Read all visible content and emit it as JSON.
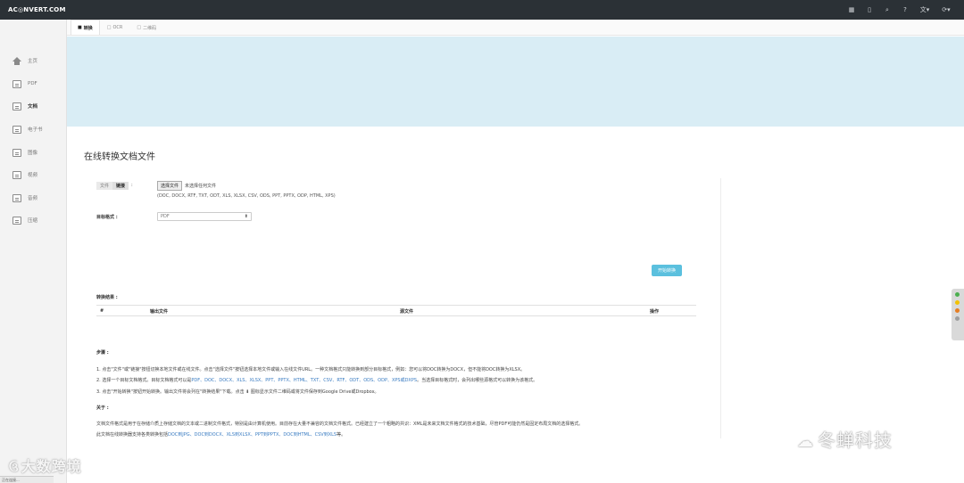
{
  "brand": {
    "logo": "AC◎NVERT.COM"
  },
  "navbar": {
    "icons": [
      {
        "name": "grid-icon",
        "glyph": "▦"
      },
      {
        "name": "bookmark-icon",
        "glyph": "▯"
      },
      {
        "name": "search-icon",
        "glyph": "⌕"
      },
      {
        "name": "help-icon",
        "glyph": "?"
      },
      {
        "name": "language-icon",
        "glyph": "文▾"
      },
      {
        "name": "refresh-icon",
        "glyph": "⟳▾"
      }
    ]
  },
  "sidebar": {
    "items": [
      {
        "label": "主页",
        "icon": "home-icon"
      },
      {
        "label": "PDF",
        "icon": "pdf-icon"
      },
      {
        "label": "文档",
        "icon": "document-icon",
        "active": true
      },
      {
        "label": "电子书",
        "icon": "ebook-icon"
      },
      {
        "label": "图像",
        "icon": "image-icon"
      },
      {
        "label": "视频",
        "icon": "video-icon"
      },
      {
        "label": "音频",
        "icon": "audio-icon"
      },
      {
        "label": "压缩",
        "icon": "archive-icon"
      }
    ]
  },
  "tabs": [
    {
      "mark": "■",
      "label": "转换",
      "active": true
    },
    {
      "mark": "□",
      "label": "OCR"
    },
    {
      "mark": "□",
      "label": "二维码"
    }
  ],
  "main": {
    "title": "在线转换文档文件",
    "source_options": [
      "文件",
      "链接"
    ],
    "colon": ":",
    "file_button": "选择文件",
    "file_status": "未选择任何文件",
    "formats_note": "(DOC, DOCX, RTF, TXT, ODT, XLS, XLSX, CSV, ODS, PPT, PPTX, ODP, HTML, XPS)",
    "target_label": "目标格式 :",
    "target_value": "PDF",
    "start_button": "开始转换",
    "results_label": "转换结果 :",
    "results_columns": [
      "#",
      "输出文件",
      "源文件",
      "操作"
    ],
    "steps_title": "步骤 :",
    "step1": "1. 点击\"文件\"或\"链接\"按钮切换本地文件或在线文件。点击\"选择文件\"按钮选择本地文件或输入在线文件URL。一种文档格式只能转换到部分目标格式，例如：您可以将DOC转换为DOCX，但不能将DOC转换为XLSX。",
    "step2_prefix": "2. 选择一个目标文档格式。目标文档格式可以是",
    "step2_links": "PDF、DOC、DOCX、XLS、XLSX、PPT、PPTX、HTML、TXT、CSV、RTF、ODT、ODS、ODP、XPS或DXPS",
    "step2_suffix": "。当选择目标格式时，会列出哪些源格式可以转换为该格式。",
    "step3": "3. 点击\"开始转换\"按钮开始转换。输出文件将会列在\"转换结果\"下载。点击 ⬇ 图标显示文件二维码或将文件保存到Google Drive或Dropbox。",
    "about_title": "关于 :",
    "about_line1": "文档文件格式是用于在存储介质上存储文档的文本或二进制文件格式，特别是由计算机使用。目前存在大量不兼容的文档文件格式。已经建立了一个粗略的共识：XML是未来文档文件格式的技术基础，尽管PDF可能仍然是固定布局文档的选择格式。",
    "about_line2_prefix": "此文档在线转换器支持各类转换包括",
    "about_line2_links": "DOC到JPG、DOC到DOCX、XLS到XLSX、PPT到PPTX、DOC到HTML、CSV到XLS",
    "about_line2_suffix": "等。"
  },
  "watermarks": {
    "left": "大数跨境",
    "right": "冬蝉科技"
  },
  "statusbar": "正在连接...",
  "colors": {
    "navbar": "#2b3136",
    "banner": "#d9edf5",
    "accent_button": "#5bc0de",
    "link": "#3a7cc2"
  }
}
